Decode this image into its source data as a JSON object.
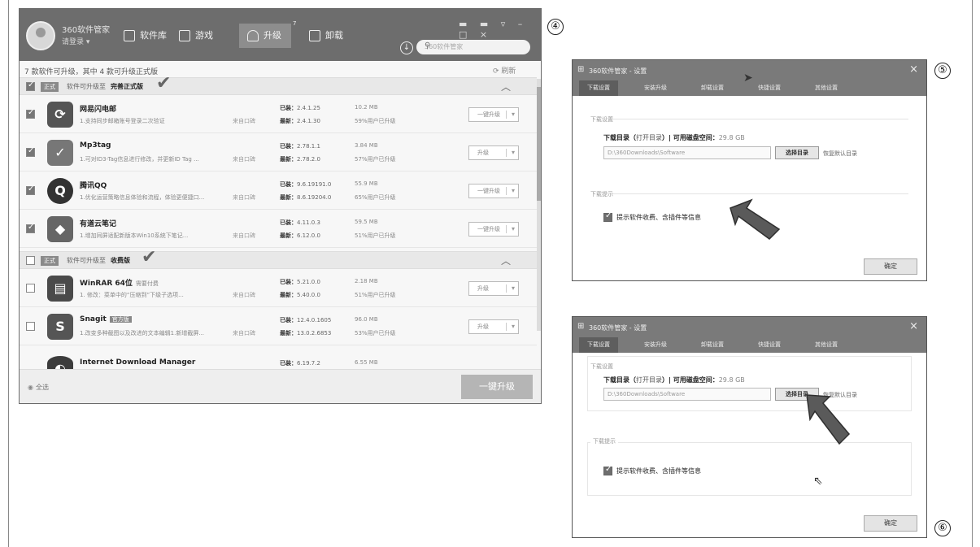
{
  "callouts": {
    "c4": "④",
    "c5": "⑤",
    "c6": "⑥"
  },
  "win4": {
    "app_name": "360软件管家",
    "user": "请登录 ▾",
    "tabs": [
      {
        "label": "软件库"
      },
      {
        "label": "游戏"
      },
      {
        "label": "升级"
      },
      {
        "label": "卸载"
      }
    ],
    "upgrade_badge": "7",
    "window_controls": "▬ ▬ ▿ – □ ×",
    "search_placeholder": "360软件管家",
    "summary": "7 款软件可升级，其中 4 款可升级正式版",
    "refresh": "刷新",
    "groups": [
      {
        "tag": "正式",
        "text": "软件可升级至",
        "bold": "完善正式版"
      },
      {
        "tag": "正式",
        "text": "软件可升级至",
        "bold": "收费版"
      }
    ],
    "rows": [
      {
        "name": "网易闪电邮",
        "desc": "1.支持同步邮箱账号登录二次验证",
        "source": "来自口碑",
        "old": "2.4.1.25",
        "new": "2.4.1.30",
        "size": "10.2 MB",
        "pct": "59%用户已升级",
        "btn": "一键升级",
        "glyph": "⟳"
      },
      {
        "name": "Mp3tag",
        "desc": "1.可对ID3-Tag信息进行修改，并更新ID Tag ...",
        "source": "来自口碑",
        "old": "2.78.1.1",
        "new": "2.78.2.0",
        "size": "3.84 MB",
        "pct": "57%用户已升级",
        "btn": "升级",
        "glyph": "✓"
      },
      {
        "name": "腾讯QQ",
        "desc": "1.优化运营策略信息体验和流程，体验更便捷口...",
        "source": "来自口碑",
        "old": "9.6.19191.0",
        "new": "8.6.19204.0",
        "size": "55.9 MB",
        "pct": "65%用户已升级",
        "btn": "一键升级",
        "glyph": "Q"
      },
      {
        "name": "有道云笔记",
        "desc": "1.增加同屏适配新版本Win10系统下笔记...",
        "source": "来自口碑",
        "old": "4.11.0.3",
        "new": "6.12.0.0",
        "size": "59.5 MB",
        "pct": "51%用户已升级",
        "btn": "一键升级",
        "glyph": "◆"
      },
      {
        "name": "WinRAR 64位",
        "badge": "",
        "note": "需要付费",
        "desc": "1. 修改：菜单中的“压缩到”下级子选项...",
        "source": "来自口碑",
        "old": "5.21.0.0",
        "new": "5.40.0.0",
        "size": "2.18 MB",
        "pct": "51%用户已升级",
        "btn": "升级",
        "glyph": "▤"
      },
      {
        "name": "Snagit",
        "badge": "官方版",
        "note": "",
        "desc": "1.改变多种截图以及改进的文本编辑1.新增截屏...",
        "source": "来自口碑",
        "old": "12.4.0.1605",
        "new": "13.0.2.6853",
        "size": "96.0 MB",
        "pct": "53%用户已升级",
        "btn": "升级",
        "glyph": "S"
      },
      {
        "name": "Internet Download Manager",
        "desc": "",
        "source": "",
        "old": "6.19.7.2",
        "new": "",
        "size": "6.55 MB",
        "pct": "",
        "btn": "",
        "glyph": "◐"
      }
    ],
    "old_label": "已装：",
    "new_label": "最新：",
    "select_all": "全选",
    "big_button": "一键升级"
  },
  "settings5": {
    "title": "360软件管家 - 设置",
    "tabs": [
      "下载设置",
      "安装升级",
      "卸载设置",
      "快捷设置",
      "其他设置"
    ],
    "section_download": "下载设置",
    "dir_label": "下载目录（",
    "open_dir": "打开目录",
    "space_label": "）| 可用磁盘空间：",
    "space_value": "29.8 GB",
    "path": "D:\\360Downloads\\Software",
    "browse": "选择目录",
    "reset": "恢复默认目录",
    "section_tips": "下载提示",
    "checkbox_label": "提示软件收费、含插件等信息",
    "ok": "确定"
  },
  "settings6": {
    "title": "360软件管家 - 设置",
    "tabs": [
      "下载设置",
      "安装升级",
      "卸载设置",
      "快捷设置",
      "其他设置"
    ],
    "section_download": "下载设置",
    "dir_label": "下载目录（",
    "open_dir": "打开目录",
    "space_label": "）| 可用磁盘空间：",
    "space_value": "29.8 GB",
    "path": "D:\\360Downloads\\Software",
    "browse": "选择目录",
    "reset": "恢复默认目录",
    "section_tips": "下载提示",
    "checkbox_label": "提示软件收费、含插件等信息",
    "ok": "确定"
  },
  "colors": {
    "titlebar": "#6d6d6d",
    "settings_titlebar": "#7a7a7a",
    "arrow": "#5a5a5a"
  }
}
